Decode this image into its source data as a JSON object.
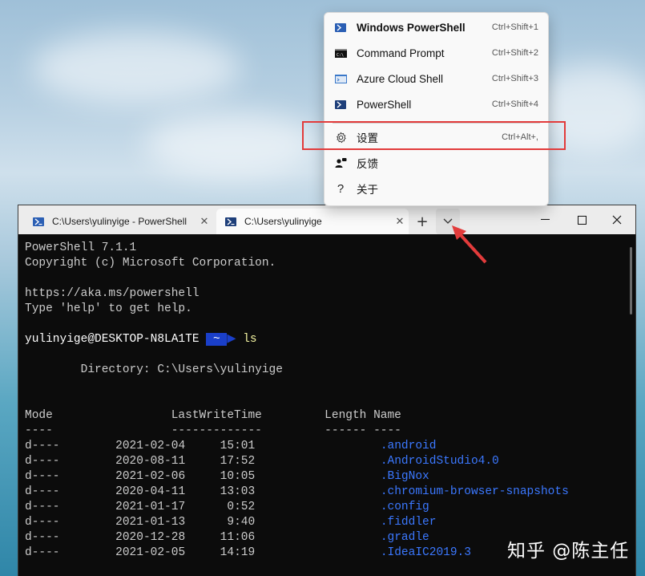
{
  "menu": {
    "items": [
      {
        "label": "Windows PowerShell",
        "shortcut": "Ctrl+Shift+1",
        "icon": "powershell-icon"
      },
      {
        "label": "Command Prompt",
        "shortcut": "Ctrl+Shift+2",
        "icon": "cmd-icon"
      },
      {
        "label": "Azure Cloud Shell",
        "shortcut": "Ctrl+Shift+3",
        "icon": "azure-icon"
      },
      {
        "label": "PowerShell",
        "shortcut": "Ctrl+Shift+4",
        "icon": "powershell-icon"
      },
      {
        "label": "设置",
        "shortcut": "Ctrl+Alt+,",
        "icon": "gear-icon"
      },
      {
        "label": "反馈",
        "shortcut": "",
        "icon": "feedback-icon"
      },
      {
        "label": "关于",
        "shortcut": "",
        "icon": "help-icon"
      }
    ]
  },
  "tabs": [
    {
      "label": "C:\\Users\\yulinyige - PowerShell",
      "close": "✕"
    },
    {
      "label": "C:\\Users\\yulinyige",
      "close": "✕"
    }
  ],
  "toolbar": {
    "new_tab": "+",
    "dropdown": "⌵"
  },
  "window_controls": {
    "minimize": "—",
    "maximize": "☐",
    "close": "✕"
  },
  "console": {
    "banner1": "PowerShell 7.1.1",
    "banner2": "Copyright (c) Microsoft Corporation.",
    "link": "https://aka.ms/powershell",
    "help": "Type 'help' to get help.",
    "prompt_user": "yulinyige@DESKTOP-N8LA1TE",
    "prompt_dir": " ~ ",
    "command": "ls",
    "directory_line": "        Directory: C:\\Users\\yulinyige",
    "header": "Mode                 LastWriteTime         Length Name",
    "header_rule": "----                 -------------         ------ ----",
    "rows": [
      {
        "mode": "d----",
        "date": "2021-02-04",
        "time": "15:01",
        "name": ".android"
      },
      {
        "mode": "d----",
        "date": "2020-08-11",
        "time": "17:52",
        "name": ".AndroidStudio4.0"
      },
      {
        "mode": "d----",
        "date": "2021-02-06",
        "time": "10:05",
        "name": ".BigNox"
      },
      {
        "mode": "d----",
        "date": "2020-04-11",
        "time": "13:03",
        "name": ".chromium-browser-snapshots"
      },
      {
        "mode": "d----",
        "date": "2021-01-17",
        "time": " 0:52",
        "name": ".config"
      },
      {
        "mode": "d----",
        "date": "2021-01-13",
        "time": " 9:40",
        "name": ".fiddler"
      },
      {
        "mode": "d----",
        "date": "2020-12-28",
        "time": "11:06",
        "name": ".gradle"
      },
      {
        "mode": "d----",
        "date": "2021-02-05",
        "time": "14:19",
        "name": ".IdeaIC2019.3"
      }
    ]
  },
  "watermark": "知乎 @陈主任",
  "colors": {
    "highlight_box": "#e23b3b",
    "dir_name": "#3b78ff",
    "prompt_bg": "#1a3fc9"
  }
}
